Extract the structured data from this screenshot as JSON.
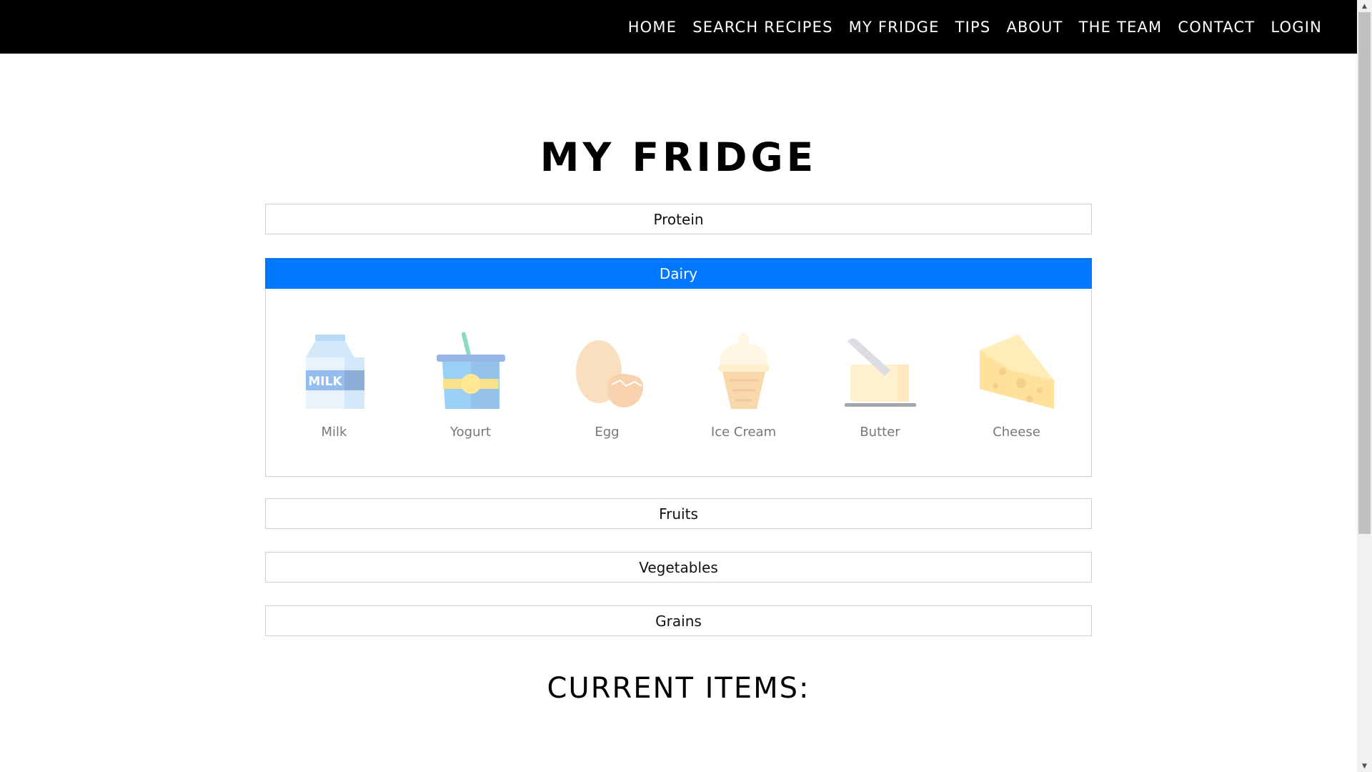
{
  "nav": {
    "items": [
      "HOME",
      "SEARCH RECIPES",
      "MY FRIDGE",
      "TIPS",
      "ABOUT",
      "THE TEAM",
      "CONTACT",
      "LOGIN"
    ]
  },
  "page": {
    "title": "MY FRIDGE",
    "current_items_title": "CURRENT ITEMS:"
  },
  "accent_color": "#0077ff",
  "categories": [
    {
      "label": "Protein",
      "expanded": false
    },
    {
      "label": "Dairy",
      "expanded": true
    },
    {
      "label": "Fruits",
      "expanded": false
    },
    {
      "label": "Vegetables",
      "expanded": false
    },
    {
      "label": "Grains",
      "expanded": false
    }
  ],
  "dairy_items": [
    {
      "label": "Milk",
      "icon": "milk-carton-icon",
      "icon_text": "MILK"
    },
    {
      "label": "Yogurt",
      "icon": "yogurt-cup-icon"
    },
    {
      "label": "Egg",
      "icon": "egg-icon"
    },
    {
      "label": "Ice Cream",
      "icon": "ice-cream-cone-icon"
    },
    {
      "label": "Butter",
      "icon": "butter-icon"
    },
    {
      "label": "Cheese",
      "icon": "cheese-icon"
    }
  ]
}
